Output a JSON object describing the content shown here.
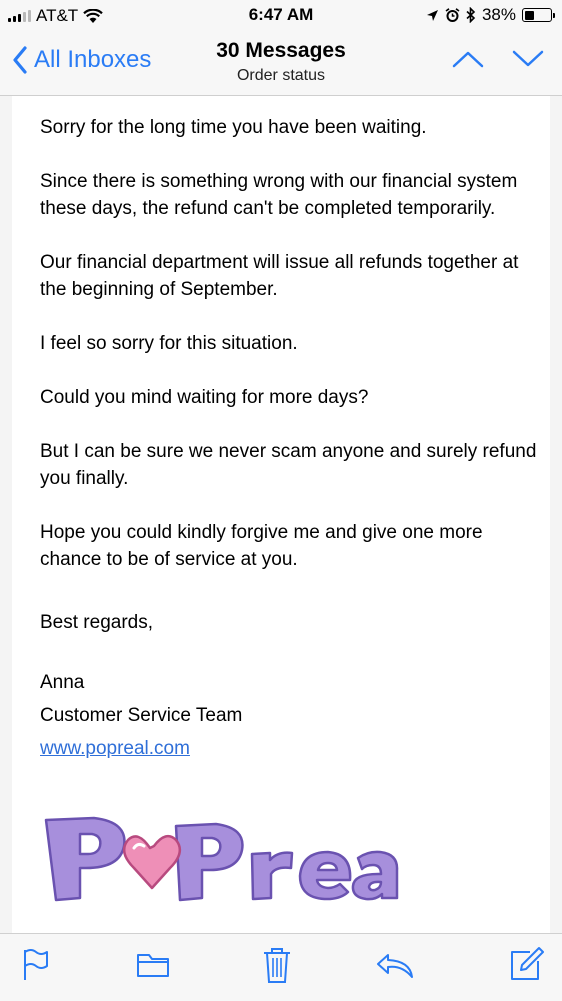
{
  "status_bar": {
    "carrier": "AT&T",
    "time": "6:47 AM",
    "battery_percent": "38%",
    "battery_level": 0.38
  },
  "nav": {
    "back_label": "All Inboxes",
    "title": "30 Messages",
    "subtitle": "Order status"
  },
  "email": {
    "paragraphs": [
      "Sorry for the long time you have been waiting.",
      "Since there is something wrong with our financial system these days, the refund can't be completed temporarily.",
      "Our financial department will issue all refunds together at the beginning of September.",
      "I feel so sorry for this situation.",
      "Could you mind waiting for more days?",
      "But I can be sure we never scam anyone and surely refund you finally.",
      "Hope you could kindly forgive me and give one more chance to be of service at you."
    ],
    "closing": "Best regards,",
    "signature_name": "Anna",
    "signature_team": "Customer Service Team",
    "signature_link": "www.popreal.com",
    "logo_text": "POPreal"
  },
  "toolbar": {
    "icons": [
      "flag-icon",
      "folder-icon",
      "trash-icon",
      "reply-icon",
      "compose-icon"
    ]
  },
  "colors": {
    "accent": "#2a7cf5",
    "link": "#2f6fd8",
    "logo_purple": "#a78fdc",
    "logo_heart": "#ee8fb7"
  }
}
